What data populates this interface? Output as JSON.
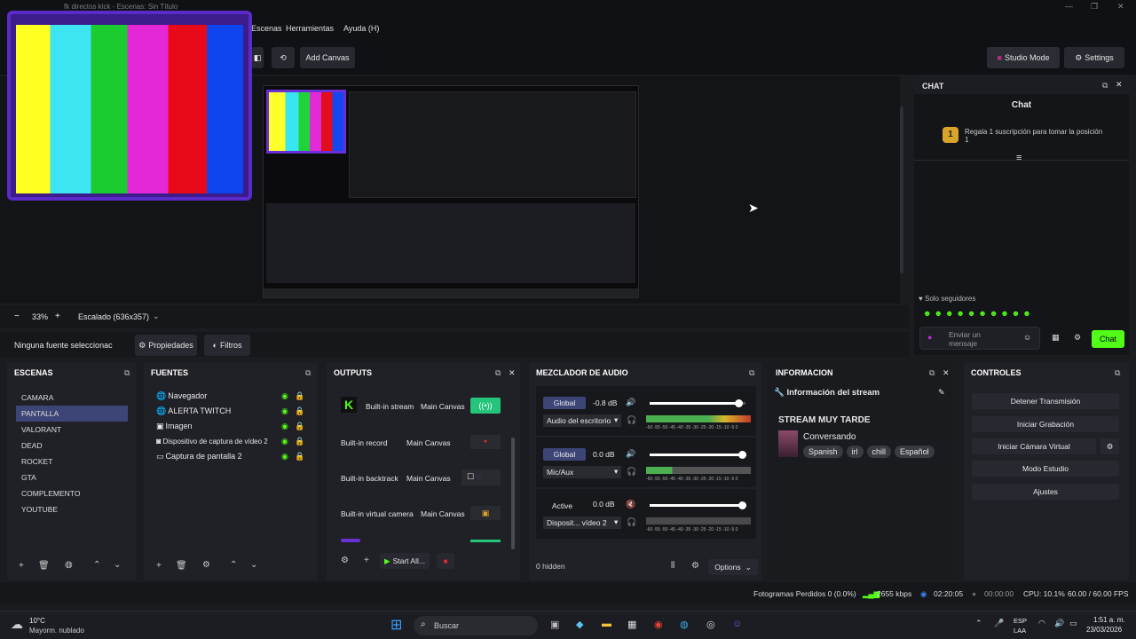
{
  "window": {
    "title": "fk directos kick - Escenas: Sin Título"
  },
  "menu": [
    "Escenas",
    "Herramientas",
    "Ayuda (H)"
  ],
  "toolbar": {
    "add_canvas": "Add Canvas",
    "studio_mode": "Studio Mode",
    "settings": "Settings"
  },
  "zoom": {
    "value": "33%",
    "scale": "Escalado (636x357)"
  },
  "sources_bar": {
    "none_selected": "Ninguna fuente seleccionac",
    "properties": "Propiedades",
    "filters": "Filtros"
  },
  "chat": {
    "header": "CHAT",
    "title": "Chat",
    "notice": "Regala 1 suscripción para tomar la posición 1",
    "followers_only": "Solo seguidores",
    "placeholder": "Enviar un mensaje",
    "send": "Chat"
  },
  "scenes": {
    "title": "ESCENAS",
    "items": [
      "CAMARA",
      "PANTALLA",
      "VALORANT",
      "DEAD",
      "ROCKET",
      "GTA",
      "COMPLEMENTO",
      "YOUTUBE"
    ],
    "selected": 1
  },
  "sources": {
    "title": "FUENTES",
    "items": [
      "Navegador",
      "ALERTA TWITCH",
      "Imagen",
      "Dispositivo de captura de vídeo 2",
      "Captura de pantalla 2"
    ]
  },
  "outputs": {
    "title": "OUTPUTS",
    "items": [
      {
        "name": "Built-in stream",
        "canvas": "Main Canvas"
      },
      {
        "name": "Built-in record",
        "canvas": "Main Canvas"
      },
      {
        "name": "Built-in backtrack",
        "canvas": "Main Canvas"
      },
      {
        "name": "Built-in virtual camera",
        "canvas": "Main Canvas"
      }
    ],
    "start_all": "Start All..."
  },
  "mixer": {
    "title": "MEZCLADOR DE AUDIO",
    "channels": [
      {
        "scope": "Global",
        "db": "-0.8 dB",
        "source": "Audio del escritorio",
        "level": 0.55
      },
      {
        "scope": "Global",
        "db": "0.0 dB",
        "source": "Mic/Aux",
        "level": 0.3
      },
      {
        "scope": "Active",
        "db": "0.0 dB",
        "source": "Disposit... vídeo 2",
        "level": 0
      }
    ],
    "hidden": "0 hidden",
    "options": "Options",
    "scale": "-60 -55 -50 -45 -40 -35 -30 -25 -20 -15 -10 -5 0"
  },
  "info": {
    "title": "INFORMACION",
    "section": "Información del stream",
    "stream_title": "STREAM MUY TARDE",
    "category": "Conversando",
    "tags": [
      "Spanish",
      "irl",
      "chill",
      "Español"
    ]
  },
  "controls": {
    "title": "CONTROLES",
    "buttons": [
      "Detener Transmisión",
      "Iniciar Grabación",
      "Iniciar Cámara Virtual",
      "Modo Estudio",
      "Ajustes"
    ]
  },
  "status": {
    "dropped": "Fotogramas Perdidos 0 (0.0%)",
    "bitrate": "2655 kbps",
    "stream_time": "02:20:05",
    "rec_time": "00:00:00",
    "cpu": "CPU: 10.1%",
    "fps": "60.00 / 60.00 FPS"
  },
  "taskbar": {
    "weather_temp": "10°C",
    "weather_desc": "Mayorm. nublado",
    "search": "Buscar",
    "lang1": "ESP",
    "lang2": "LAA",
    "time": "1:51 a. m.",
    "date": "23/03/2026"
  }
}
